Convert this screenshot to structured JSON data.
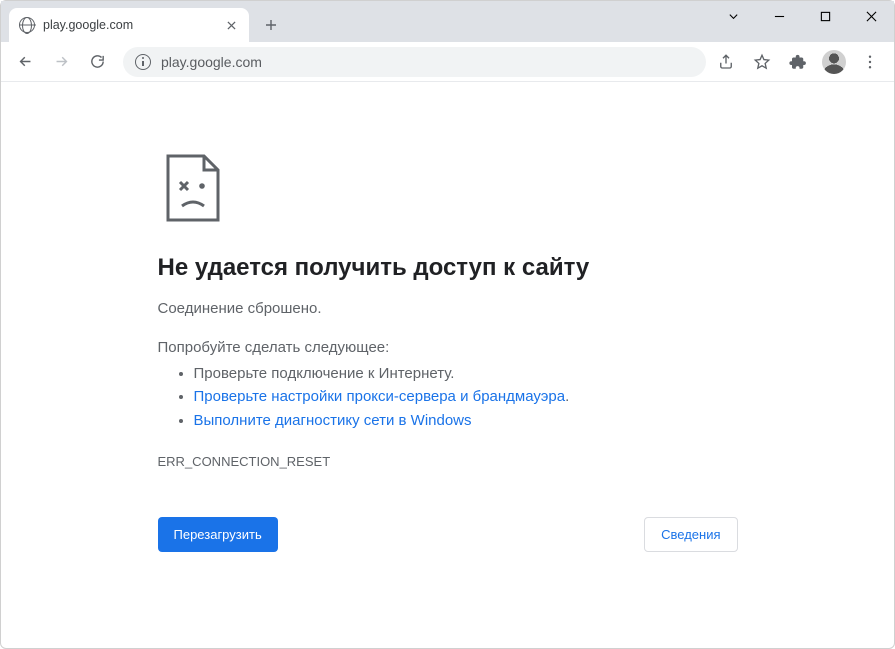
{
  "window": {
    "tab_title": "play.google.com",
    "url": "play.google.com"
  },
  "error": {
    "title": "Не удается получить доступ к сайту",
    "subtitle": "Соединение сброшено.",
    "try_heading": "Попробуйте сделать следующее:",
    "suggestions": {
      "s0": "Проверьте подключение к Интернету.",
      "s1": "Проверьте настройки прокси-сервера и брандмауэра",
      "s2": "Выполните диагностику сети в Windows"
    },
    "code": "ERR_CONNECTION_RESET",
    "reload_label": "Перезагрузить",
    "details_label": "Сведения"
  }
}
